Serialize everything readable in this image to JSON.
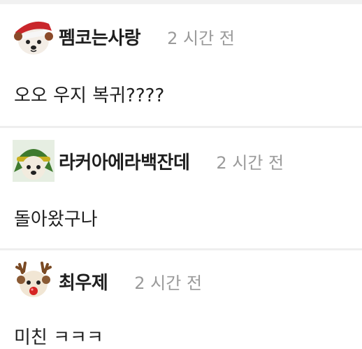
{
  "comments": [
    {
      "username": "펨코는사랑",
      "timestamp": "2 시간 전",
      "text": "오오 우지 복귀????",
      "avatar_icon": "santa-hat-dog-icon"
    },
    {
      "username": "라커아에라백잔데",
      "timestamp": "2 시간 전",
      "text": "돌아왔구나",
      "avatar_icon": "elf-hat-dog-icon"
    },
    {
      "username": "최우제",
      "timestamp": "2 시간 전",
      "text": "미친 ㅋㅋㅋ",
      "avatar_icon": "reindeer-dog-icon"
    }
  ],
  "colors": {
    "username": "#1e1e1e",
    "timestamp": "#9a9a9a",
    "divider": "#eeeeee",
    "background": "#ffffff"
  }
}
